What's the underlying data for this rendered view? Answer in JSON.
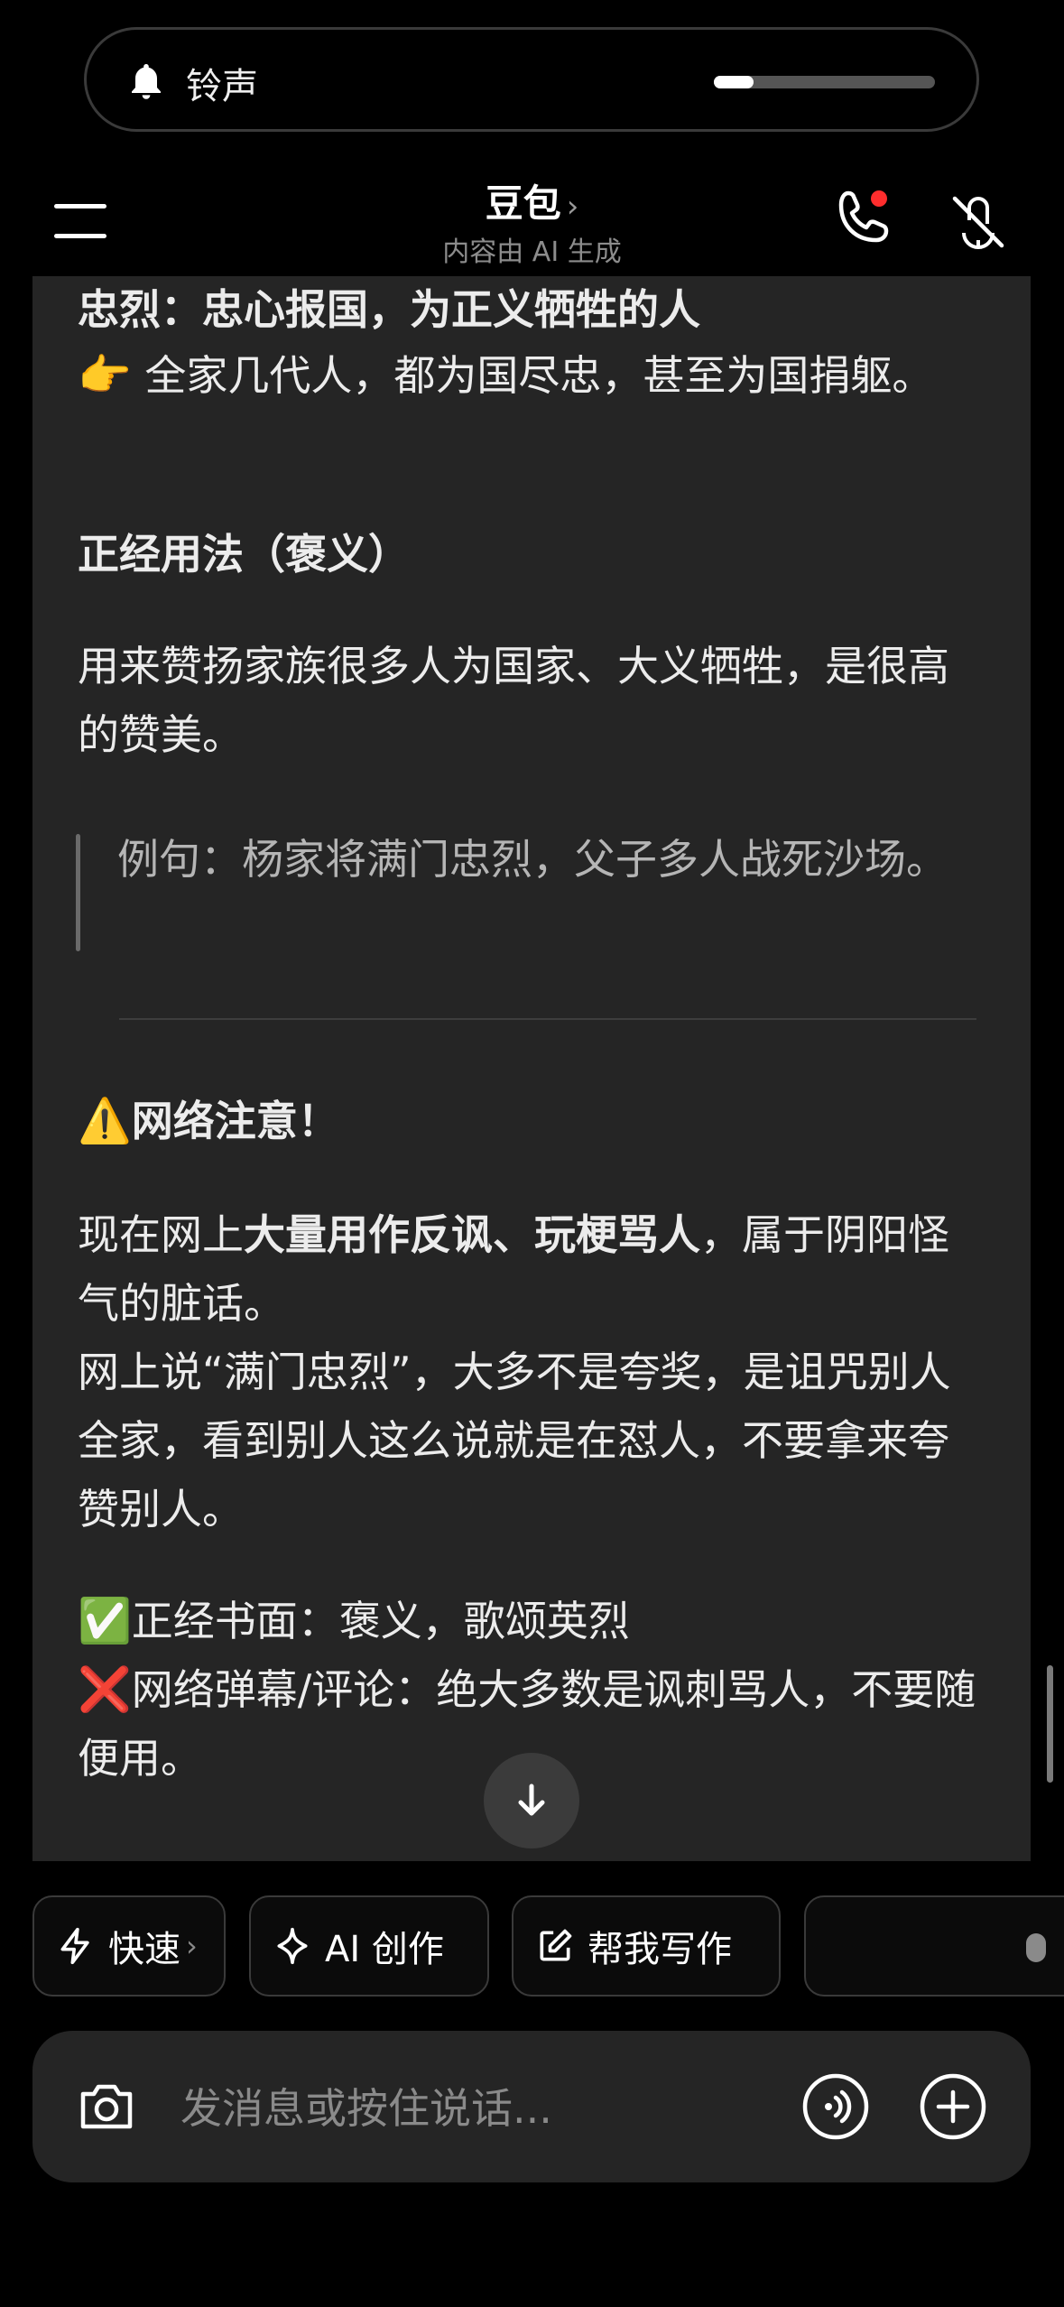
{
  "ringer": {
    "label": "铃声",
    "volume_fraction": 0.18
  },
  "nav": {
    "title": "豆包",
    "title_chevron": "›",
    "subtitle": "内容由 AI 生成"
  },
  "content": {
    "heading_zhonglie": "忠烈：忠心报国，为正义牺牲的人",
    "point_emoji": "👉",
    "zhonglie_desc": " 全家几代人，都为国尽忠，甚至为国捐躯。",
    "proper_usage_heading": "正经用法（褒义）",
    "proper_usage_desc": "用来赞扬家族很多人为国家、大义牺牲，是很高的赞美。",
    "example": "例句：杨家将满门忠烈，父子多人战死沙场。",
    "warning_emoji": "⚠️",
    "warning_heading": "网络注意！",
    "net_p1_prefix": "现在网上",
    "net_p1_bold": "大量用作反讽、玩梗骂人",
    "net_p1_suffix": "，属于阴阳怪气的脏话。",
    "net_p2": "网上说“满门忠烈”，大多不是夸奖，是诅咒别人全家，看到别人这么说就是在怼人，不要拿来夸赞别人。",
    "check_emoji": "✅",
    "check_text": "正经书面：褒义，歌颂英烈",
    "cross_emoji": "❌",
    "cross_text": "网络弹幕/评论：绝大多数是讽刺骂人，不要随便用。"
  },
  "chips": [
    {
      "label": "快速",
      "chevron": "›"
    },
    {
      "label": "AI 创作"
    },
    {
      "label": "帮我写作"
    }
  ],
  "input": {
    "placeholder": "发消息或按住说话..."
  }
}
